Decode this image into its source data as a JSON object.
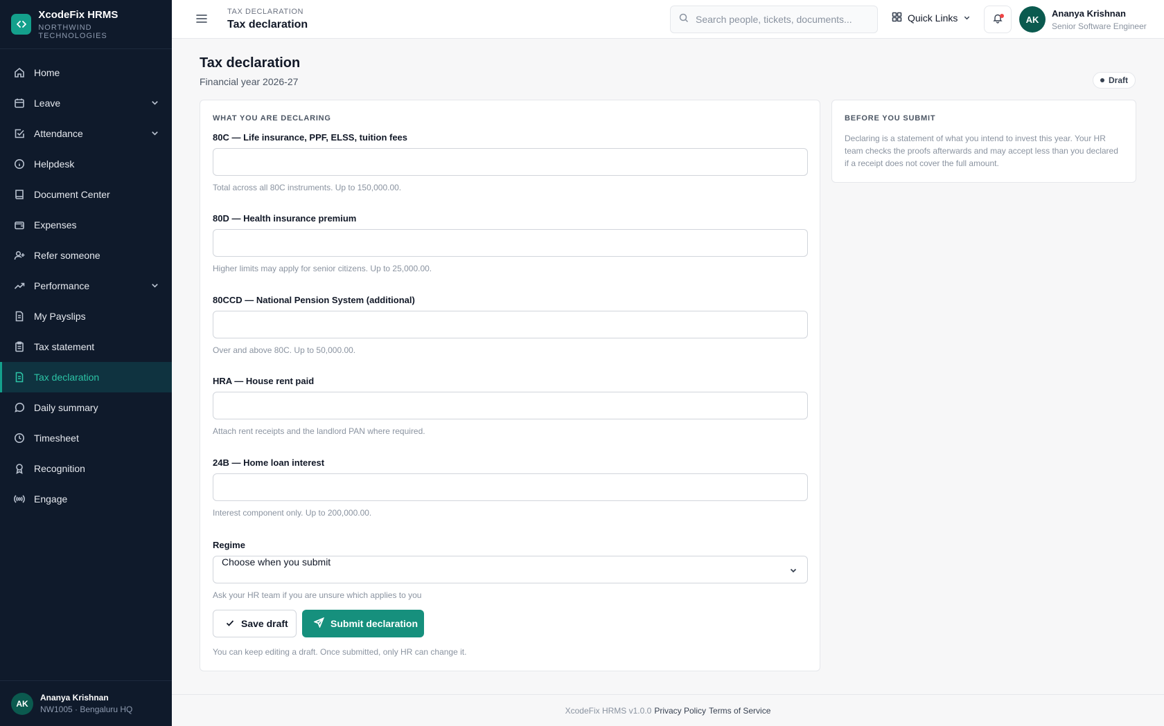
{
  "app": {
    "name": "XcodeFix HRMS",
    "org": "NORTHWIND TECHNOLOGIES"
  },
  "sidebar": {
    "items": [
      {
        "label": "Home",
        "icon": "home-icon"
      },
      {
        "label": "Leave",
        "icon": "calendar-icon",
        "expandable": true
      },
      {
        "label": "Attendance",
        "icon": "check-square-icon",
        "expandable": true
      },
      {
        "label": "Helpdesk",
        "icon": "info-icon"
      },
      {
        "label": "Document Center",
        "icon": "book-icon"
      },
      {
        "label": "Expenses",
        "icon": "wallet-icon"
      },
      {
        "label": "Refer someone",
        "icon": "user-plus-icon"
      },
      {
        "label": "Performance",
        "icon": "trend-up-icon",
        "expandable": true
      },
      {
        "label": "My Payslips",
        "icon": "file-icon"
      },
      {
        "label": "Tax statement",
        "icon": "clipboard-icon"
      },
      {
        "label": "Tax declaration",
        "icon": "file-text-icon",
        "active": true
      },
      {
        "label": "Daily summary",
        "icon": "message-circle-icon"
      },
      {
        "label": "Timesheet",
        "icon": "clock-icon"
      },
      {
        "label": "Recognition",
        "icon": "award-icon"
      },
      {
        "label": "Engage",
        "icon": "radio-icon"
      }
    ],
    "user": {
      "initials": "AK",
      "name": "Ananya Krishnan",
      "meta": "NW1005 · Bengaluru HQ"
    }
  },
  "topbar": {
    "breadcrumb": "TAX DECLARATION",
    "title": "Tax declaration",
    "search_placeholder": "Search people, tickets, documents...",
    "quick_links": "Quick Links",
    "user": {
      "initials": "AK",
      "name": "Ananya Krishnan",
      "role": "Senior Software Engineer"
    }
  },
  "page": {
    "title": "Tax declaration",
    "subtitle": "Financial year 2026-27",
    "status": "Draft"
  },
  "form": {
    "section": "WHAT YOU ARE DECLARING",
    "fields": [
      {
        "label": "80C — Life insurance, PPF, ELSS, tuition fees",
        "value": "",
        "help": "Total across all 80C instruments. Up to 150,000.00."
      },
      {
        "label": "80D — Health insurance premium",
        "value": "",
        "help": "Higher limits may apply for senior citizens. Up to 25,000.00."
      },
      {
        "label": "80CCD — National Pension System (additional)",
        "value": "",
        "help": "Over and above 80C. Up to 50,000.00."
      },
      {
        "label": "HRA — House rent paid",
        "value": "",
        "help": "Attach rent receipts and the landlord PAN where required."
      },
      {
        "label": "24B — Home loan interest",
        "value": "",
        "help": "Interest component only. Up to 200,000.00."
      }
    ],
    "regime": {
      "label": "Regime",
      "selected": "Choose when you submit",
      "help": "Ask your HR team if you are unsure which applies to you"
    },
    "save_label": "Save draft",
    "submit_label": "Submit declaration",
    "note": "You can keep editing a draft. Once submitted, only HR can change it."
  },
  "side_panel": {
    "title": "BEFORE YOU SUBMIT",
    "text": "Declaring is a statement of what you intend to invest this year. Your HR team checks the proofs afterwards and may accept less than you declared if a receipt does not cover the full amount."
  },
  "footer": {
    "version": "XcodeFix HRMS v1.0.0",
    "privacy": "Privacy Policy",
    "terms": "Terms of Service"
  },
  "colors": {
    "sidebar_bg": "#0f1a2b",
    "accent": "#16907d",
    "active_text": "#2cc4a6"
  }
}
